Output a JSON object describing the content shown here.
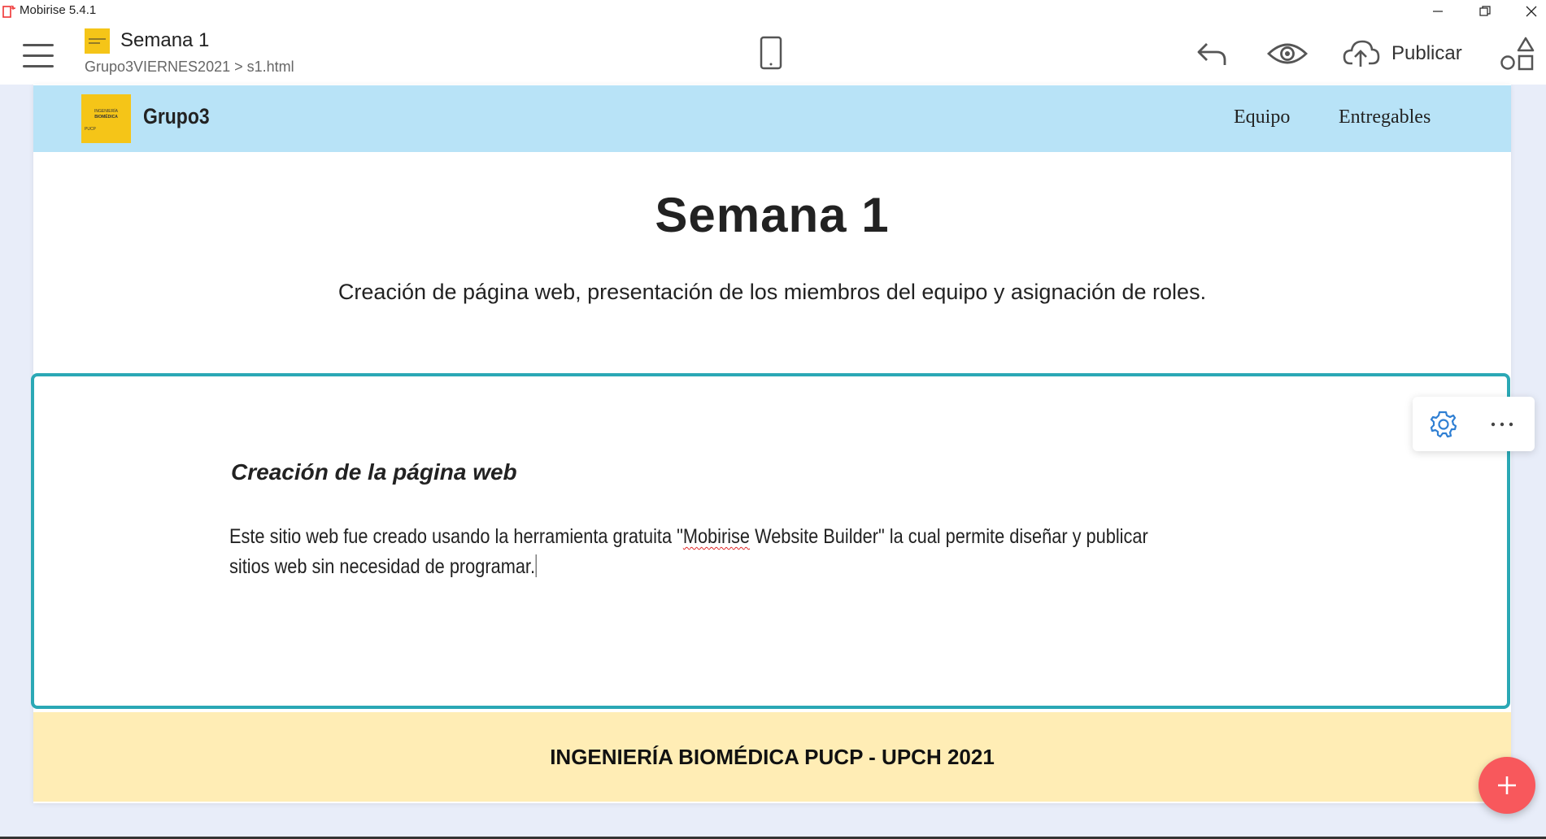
{
  "window": {
    "title": "Mobirise 5.4.1"
  },
  "toolbar": {
    "page_title": "Semana 1",
    "breadcrumb": "Grupo3VIERNES2021 > s1.html",
    "publish_label": "Publicar",
    "icons": [
      "menu-icon",
      "phone-icon",
      "undo-icon",
      "eye-icon",
      "cloud-upload-icon",
      "blocks-icon"
    ]
  },
  "site": {
    "brand_name": "Grupo3",
    "logo_text": {
      "line1": "INGENIERÍA",
      "line2": "BIOMÉDICA",
      "line3": "PUCP"
    },
    "nav_links": [
      "Equipo",
      "Entregables"
    ],
    "heading": "Semana 1",
    "subtitle": "Creación de página web, presentación de los miembros del equipo y asignación de roles.",
    "content_heading": "Creación de la página web",
    "content_text_before": "Este sitio web fue creado usando la herramienta gratuita \"",
    "content_text_spell": "Mobirise",
    "content_text_after": " Website Builder\" la cual permite diseñar y publicar sitios web sin necesidad de programar.",
    "footer": "INGENIERÍA BIOMÉDICA PUCP - UPCH 2021"
  },
  "colors": {
    "nav_bg": "#b8e3f7",
    "footer_bg": "#ffedb5",
    "block_border": "#2ba8b5",
    "add_button": "#f8585c",
    "logo_yellow": "#f5c518"
  }
}
